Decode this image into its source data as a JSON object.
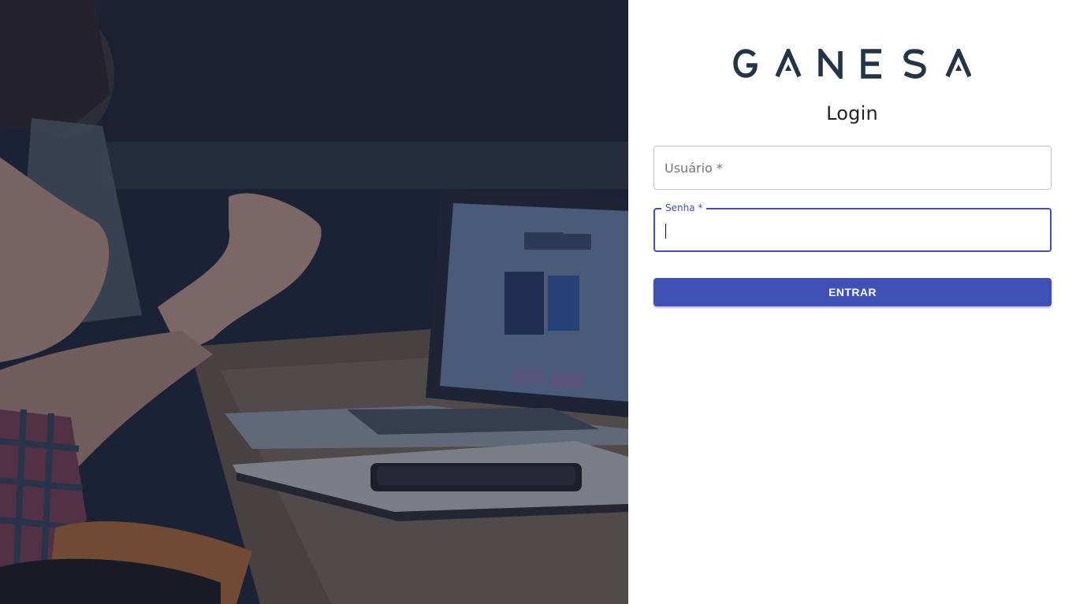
{
  "brand": {
    "logo_text": "GANESA",
    "color": "#243447"
  },
  "login": {
    "title": "Login",
    "username_placeholder": "Usuário *",
    "username_value": "",
    "password_label": "Senha *",
    "password_value": "",
    "submit_label": "ENTRAR"
  },
  "colors": {
    "primary": "#3f51b5",
    "hero_overlay": "#1c2438"
  },
  "hero": {
    "image": "meeting-photo"
  }
}
